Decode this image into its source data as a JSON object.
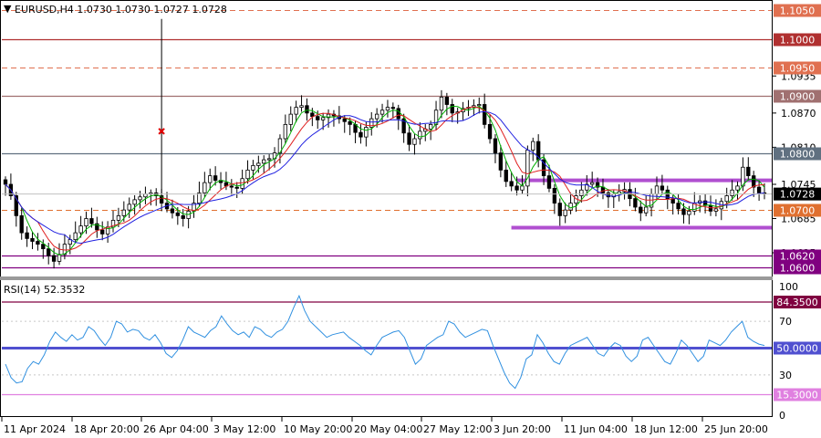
{
  "chart_data": {
    "type": "candlestick",
    "header": "EURUSD,H4  1.0730 1.0730 1.0727 1.0728",
    "symbol": "EURUSD",
    "timeframe": "H4",
    "ohlc_last": {
      "open": 1.073,
      "high": 1.073,
      "low": 1.0727,
      "close": 1.0728
    },
    "price_ylim": [
      1.0585,
      1.1065
    ],
    "price_ticks": [
      "1.0935",
      "1.0870",
      "1.0810",
      "1.0745",
      "1.0685",
      "1.0625"
    ],
    "x_tick_labels": [
      "11 Apr 2024",
      "18 Apr 20:00",
      "26 Apr 04:00",
      "3 May 12:00",
      "10 May 20:00",
      "20 May 04:00",
      "27 May 12:00",
      "3 Jun 20:00",
      "11 Jun 04:00",
      "18 Jun 12:00",
      "25 Jun 20:00"
    ],
    "current_price_label": "1.0728",
    "levels": [
      {
        "value": 1.105,
        "label": "1.1050",
        "style": "dashed",
        "color": "#e07050"
      },
      {
        "value": 1.1,
        "label": "1.1000",
        "style": "solid",
        "color": "#b03030"
      },
      {
        "value": 1.095,
        "label": "1.0950",
        "style": "dashed",
        "color": "#e07050"
      },
      {
        "value": 1.09,
        "label": "1.0900",
        "style": "solid",
        "color": "#a07070"
      },
      {
        "value": 1.08,
        "label": "1.0800",
        "style": "solid",
        "color": "#607080"
      },
      {
        "value": 1.07,
        "label": "1.0700",
        "style": "dashed",
        "color": "#e07030"
      },
      {
        "value": 1.062,
        "label": "1.0620",
        "style": "solid",
        "color": "#800080"
      },
      {
        "value": 1.06,
        "label": "1.0600",
        "style": "solid",
        "color": "#800080"
      }
    ],
    "range_box": {
      "upper": 1.0752,
      "lower": 1.0669,
      "color": "#b04fd0"
    },
    "close_series": [
      1.0745,
      1.0725,
      1.069,
      1.066,
      1.065,
      1.0645,
      1.064,
      1.0632,
      1.062,
      1.061,
      1.0622,
      1.064,
      1.0648,
      1.066,
      1.0672,
      1.0685,
      1.0676,
      1.0665,
      1.0658,
      1.067,
      1.0682,
      1.069,
      1.07,
      1.071,
      1.0718,
      1.0723,
      1.0728,
      1.073,
      1.0725,
      1.0712,
      1.0702,
      1.0695,
      1.069,
      1.0685,
      1.0698,
      1.0712,
      1.073,
      1.0748,
      1.076,
      1.0752,
      1.0748,
      1.0742,
      1.074,
      1.0738,
      1.0755,
      1.077,
      1.0778,
      1.0782,
      1.0788,
      1.079,
      1.08,
      1.0825,
      1.085,
      1.0868,
      1.088,
      1.0883,
      1.087,
      1.0864,
      1.0858,
      1.0862,
      1.0868,
      1.0865,
      1.086,
      1.0855,
      1.085,
      1.0836,
      1.0828,
      1.0845,
      1.086,
      1.0868,
      1.0875,
      1.088,
      1.0878,
      1.086,
      1.0835,
      1.0815,
      1.0825,
      1.0838,
      1.0842,
      1.085,
      1.0875,
      1.0898,
      1.0885,
      1.087,
      1.0872,
      1.0878,
      1.088,
      1.0883,
      1.0885,
      1.085,
      1.0825,
      1.08,
      1.077,
      1.075,
      1.0742,
      1.0735,
      1.0742,
      1.0805,
      1.082,
      1.0788,
      1.076,
      1.0738,
      1.0712,
      1.069,
      1.07,
      1.0712,
      1.0725,
      1.0735,
      1.0745,
      1.0748,
      1.074,
      1.073,
      1.0723,
      1.0728,
      1.0732,
      1.0736,
      1.072,
      1.0705,
      1.0695,
      1.0705,
      1.0728,
      1.0742,
      1.0735,
      1.072,
      1.0712,
      1.0702,
      1.0692,
      1.0698,
      1.0712,
      1.0716,
      1.0708,
      1.0698,
      1.0702,
      1.0715,
      1.0725,
      1.0735,
      1.0742,
      1.0775,
      1.076,
      1.074,
      1.073,
      1.0728
    ],
    "sma_fast_color": "#00b000",
    "sma_mid_color": "#e02020",
    "sma_slow_color": "#2020e0",
    "rsi": {
      "label": "RSI(14) 52.3532",
      "value": 52.3532,
      "ylim": [
        0,
        100
      ],
      "levels": [
        {
          "value": 84.35,
          "label": "84.3500",
          "color": "#800040"
        },
        {
          "value": 50.0,
          "label": "50.0000",
          "color": "#5050d0"
        },
        {
          "value": 15.3,
          "label": "15.3000",
          "color": "#e080e0"
        }
      ],
      "ticks": [
        "100",
        "70",
        "30",
        "0"
      ],
      "series": [
        38,
        28,
        24,
        25,
        35,
        40,
        38,
        45,
        55,
        62,
        58,
        55,
        60,
        56,
        58,
        66,
        63,
        57,
        52,
        58,
        70,
        68,
        62,
        64,
        63,
        58,
        56,
        60,
        54,
        46,
        43,
        48,
        56,
        66,
        62,
        60,
        58,
        63,
        66,
        74,
        68,
        63,
        60,
        62,
        58,
        66,
        64,
        60,
        58,
        62,
        64,
        70,
        80,
        89,
        78,
        70,
        66,
        62,
        58,
        60,
        61,
        62,
        58,
        55,
        52,
        48,
        45,
        52,
        58,
        60,
        62,
        63,
        58,
        48,
        38,
        42,
        52,
        55,
        58,
        60,
        70,
        68,
        62,
        58,
        60,
        62,
        64,
        63,
        52,
        42,
        32,
        24,
        20,
        28,
        42,
        45,
        60,
        54,
        46,
        40,
        38,
        46,
        52,
        54,
        56,
        58,
        52,
        46,
        44,
        50,
        54,
        52,
        44,
        40,
        44,
        56,
        58,
        52,
        46,
        40,
        38,
        46,
        56,
        52,
        46,
        40,
        44,
        56,
        54,
        52,
        56,
        62,
        66,
        70,
        58,
        55,
        53,
        52
      ]
    }
  }
}
